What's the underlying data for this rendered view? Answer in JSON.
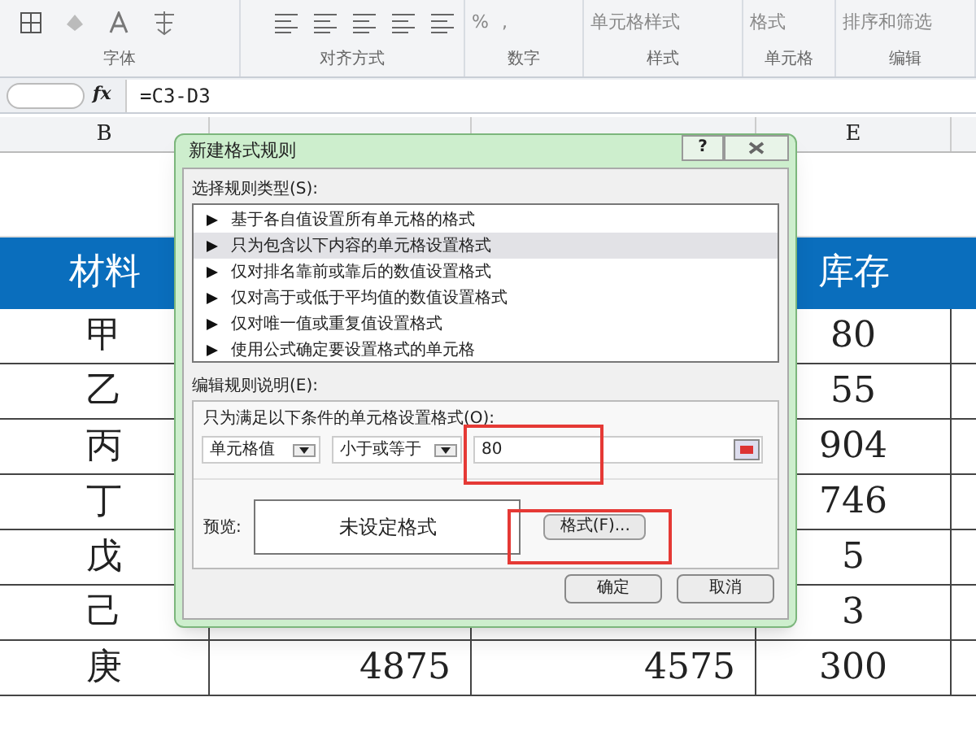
{
  "ribbon": {
    "groups": [
      {
        "label": "字体"
      },
      {
        "label": "对齐方式"
      },
      {
        "label": "数字",
        "items": [
          "%",
          ","
        ]
      },
      {
        "label": "样式",
        "items": [
          "单元格样式"
        ]
      },
      {
        "label": "单元格",
        "items": [
          "格式"
        ]
      },
      {
        "label": "编辑",
        "items": [
          "排序和筛选"
        ]
      }
    ]
  },
  "formula_bar": {
    "function_label": "fx",
    "formula": "=C3-D3"
  },
  "columns": {
    "b": "B",
    "e": "E"
  },
  "table": {
    "header": {
      "b": "材料",
      "e": "库存"
    },
    "rows": [
      {
        "b": "甲",
        "e": "80"
      },
      {
        "b": "乙",
        "e": "55"
      },
      {
        "b": "丙",
        "e": "904"
      },
      {
        "b": "丁",
        "e": "746"
      },
      {
        "b": "戊",
        "e": "5"
      },
      {
        "b": "己",
        "e": "3"
      },
      {
        "b": "庚",
        "c": "4875",
        "d": "4575",
        "e": "300"
      }
    ]
  },
  "dialog": {
    "title": "新建格式规则",
    "help": "?",
    "rule_type_label": "选择规则类型(S):",
    "rule_types": [
      {
        "label": "基于各自值设置所有单元格的格式",
        "selected": false
      },
      {
        "label": "只为包含以下内容的单元格设置格式",
        "selected": true
      },
      {
        "label": "仅对排名靠前或靠后的数值设置格式",
        "selected": false
      },
      {
        "label": "仅对高于或低于平均值的数值设置格式",
        "selected": false
      },
      {
        "label": "仅对唯一值或重复值设置格式",
        "selected": false
      },
      {
        "label": "使用公式确定要设置格式的单元格",
        "selected": false
      }
    ],
    "description_label": "编辑规则说明(E):",
    "condition_label": "只为满足以下条件的单元格设置格式(O):",
    "cell_field": "单元格值",
    "operator_field": "小于或等于",
    "value": "80",
    "preview_label": "预览:",
    "preview_text": "未设定格式",
    "format_button": "格式(F)...",
    "buttons": [
      "确定",
      "取消"
    ]
  }
}
